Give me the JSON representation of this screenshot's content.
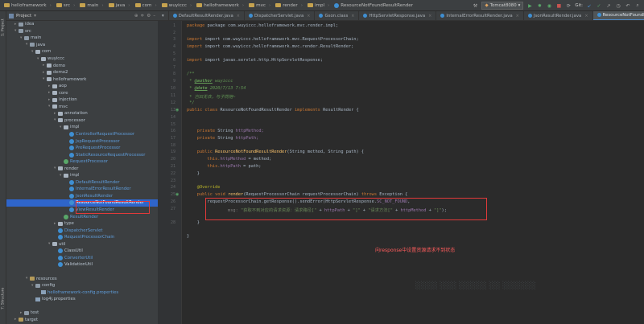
{
  "navbar": {
    "breadcrumbs": [
      "helloframework",
      "src",
      "main",
      "java",
      "com",
      "wuyiccc",
      "helloframework",
      "mvc",
      "render",
      "impl",
      "ResourceNotFoundResultRender"
    ],
    "run_config": "Tomcat8080",
    "git_label": "Git:"
  },
  "stripe": {
    "top_tabs": [
      "1: Project",
      "7: Structure"
    ],
    "bottom_tabs": [
      "Web",
      "2: Favorites"
    ]
  },
  "project": {
    "title": "Project",
    "tree": [
      {
        "label": "idea",
        "depth": 1,
        "arrow": "▸",
        "icon": "folder"
      },
      {
        "label": "src",
        "depth": 1,
        "arrow": "▾",
        "icon": "folder"
      },
      {
        "label": "main",
        "depth": 2,
        "arrow": "▾",
        "icon": "folder"
      },
      {
        "label": "java",
        "depth": 3,
        "arrow": "▾",
        "icon": "folder"
      },
      {
        "label": "com",
        "depth": 4,
        "arrow": "▾",
        "icon": "pkg"
      },
      {
        "label": "wuyiccc",
        "depth": 5,
        "arrow": "▾",
        "icon": "pkg"
      },
      {
        "label": "demo",
        "depth": 6,
        "arrow": "▸",
        "icon": "pkg"
      },
      {
        "label": "demo2",
        "depth": 6,
        "arrow": "▸",
        "icon": "pkg"
      },
      {
        "label": "helloframework",
        "depth": 6,
        "arrow": "▾",
        "icon": "pkg"
      },
      {
        "label": "aop",
        "depth": 7,
        "arrow": "▸",
        "icon": "pkg"
      },
      {
        "label": "core",
        "depth": 7,
        "arrow": "▸",
        "icon": "pkg"
      },
      {
        "label": "injection",
        "depth": 7,
        "arrow": "▸",
        "icon": "pkg"
      },
      {
        "label": "mvc",
        "depth": 7,
        "arrow": "▾",
        "icon": "pkg"
      },
      {
        "label": "annotation",
        "depth": 8,
        "arrow": "▸",
        "icon": "pkg"
      },
      {
        "label": "processor",
        "depth": 8,
        "arrow": "▾",
        "icon": "pkg"
      },
      {
        "label": "impl",
        "depth": 9,
        "arrow": "▾",
        "icon": "pkg"
      },
      {
        "label": "ControllerRequestProcessor",
        "depth": 10,
        "arrow": "",
        "icon": "cls",
        "blue": true
      },
      {
        "label": "JspRequestProcessor",
        "depth": 10,
        "arrow": "",
        "icon": "cls",
        "blue": true
      },
      {
        "label": "PreRequestProcessor",
        "depth": 10,
        "arrow": "",
        "icon": "cls",
        "blue": true
      },
      {
        "label": "StaticResourceRequestProcessor",
        "depth": 10,
        "arrow": "",
        "icon": "cls",
        "blue": true
      },
      {
        "label": "RequestProcessor",
        "depth": 9,
        "arrow": "",
        "icon": "cls-i",
        "blue": true
      },
      {
        "label": "render",
        "depth": 8,
        "arrow": "▾",
        "icon": "pkg"
      },
      {
        "label": "impl",
        "depth": 9,
        "arrow": "▾",
        "icon": "pkg"
      },
      {
        "label": "DefaultResultRender",
        "depth": 10,
        "arrow": "",
        "icon": "cls",
        "blue": true
      },
      {
        "label": "InternalErrorResultRender",
        "depth": 10,
        "arrow": "",
        "icon": "cls",
        "blue": true
      },
      {
        "label": "JsonResultRender",
        "depth": 10,
        "arrow": "",
        "icon": "cls",
        "blue": true
      },
      {
        "label": "ResourceNotFoundResultRender",
        "depth": 10,
        "arrow": "",
        "icon": "cls",
        "highlight": true
      },
      {
        "label": "ViewResultRender",
        "depth": 10,
        "arrow": "",
        "icon": "cls",
        "blue": true
      },
      {
        "label": "ResultRender",
        "depth": 9,
        "arrow": "",
        "icon": "cls-i",
        "blue": true
      },
      {
        "label": "type",
        "depth": 8,
        "arrow": "▸",
        "icon": "pkg"
      },
      {
        "label": "DispatcherServlet",
        "depth": 8,
        "arrow": "",
        "icon": "cls",
        "blue": true
      },
      {
        "label": "RequestProcessorChain",
        "depth": 8,
        "arrow": "",
        "icon": "cls",
        "blue": true
      },
      {
        "label": "util",
        "depth": 7,
        "arrow": "▾",
        "icon": "pkg"
      },
      {
        "label": "ClassUtil",
        "depth": 8,
        "arrow": "",
        "icon": "cls"
      },
      {
        "label": "ConverterUtil",
        "depth": 8,
        "arrow": "",
        "icon": "cls",
        "blue": true
      },
      {
        "label": "ValidationUtil",
        "depth": 8,
        "arrow": "",
        "icon": "cls"
      },
      {
        "label": "",
        "depth": 0,
        "arrow": "",
        "icon": "none"
      },
      {
        "label": "resources",
        "depth": 3,
        "arrow": "▾",
        "icon": "res"
      },
      {
        "label": "config",
        "depth": 4,
        "arrow": "▾",
        "icon": "folder"
      },
      {
        "label": "helloframework-config.properties",
        "depth": 5,
        "arrow": "",
        "icon": "file",
        "blue": true
      },
      {
        "label": "log4j.properties",
        "depth": 4,
        "arrow": "",
        "icon": "file"
      },
      {
        "label": "",
        "depth": 0,
        "arrow": "",
        "icon": "none"
      },
      {
        "label": "test",
        "depth": 2,
        "arrow": "▸",
        "icon": "folder"
      },
      {
        "label": "target",
        "depth": 1,
        "arrow": "▸",
        "icon": "res"
      },
      {
        "label": "helloframework.iml",
        "depth": 1,
        "arrow": "",
        "icon": "file"
      },
      {
        "label": "pom.xml",
        "depth": 1,
        "arrow": "",
        "icon": "xml",
        "blue": true
      }
    ]
  },
  "tabs": [
    {
      "label": "DefaultResultRender.java"
    },
    {
      "label": "DispatcherServlet.java"
    },
    {
      "label": "Gson.class"
    },
    {
      "label": "HttpServletResponse.java"
    },
    {
      "label": "InternalErrorResultRender.java"
    },
    {
      "label": "JsonResultRender.java"
    },
    {
      "label": "ResourceNotFoundResultRender.java",
      "active": true
    }
  ],
  "editor": {
    "line_numbers": [
      "1",
      "2",
      "3",
      "4",
      "5",
      "6",
      "7",
      "8",
      "9",
      "10",
      "11",
      "12",
      "13",
      "14",
      "15",
      "16",
      "17",
      "18",
      "19",
      "20",
      "21",
      "22",
      "23",
      "24",
      "25",
      "26",
      "27",
      "28"
    ],
    "code": {
      "l1": [
        "package com.wuyiccc.helloframework.mvc.render.impl;"
      ],
      "l3": [
        "import com.wuyiccc.helloframework.mvc.RequestProcessorChain;"
      ],
      "l4": [
        "import com.wuyiccc.helloframework.mvc.render.ResultRender;"
      ],
      "l6": [
        "import javax.servlet.http.HttpServletResponse;"
      ],
      "l8": "/**",
      "l9_tag": "@author",
      "l9_val": "wuyiccc",
      "l10_tag": "@date",
      "l10_val": "2020/7/13 7:54",
      "l11": " * 岂曰无衣，与子同袍~",
      "l12": " */",
      "l13_a": "public class",
      "l13_b": "ResourceNotFoundResultRender",
      "l13_c": "implements",
      "l13_d": "ResultRender {",
      "l16_a": "private",
      "l16_b": "String",
      "l16_c": "httpMethod;",
      "l17_a": "private",
      "l17_b": "String",
      "l17_c": "httpPath;",
      "l19_a": "public",
      "l19_b": "ResourceNotFoundResultRender",
      "l19_c": "(String method, String path) {",
      "l20_a": "this.",
      "l20_b": "httpMethod",
      "l20_c": " = method;",
      "l21_a": "this.",
      "l21_b": "httpPath",
      "l21_c": " = path;",
      "l22": "}",
      "l24": "@Override",
      "l25_a": "public void",
      "l25_b": "render",
      "l25_c": "(RequestProcessorChain requestProcessorChain)",
      "l25_d": "throws",
      "l25_e": "Exception {",
      "l26_a": "requestProcessorChain.getResponse().sendError(HttpServletResponse.",
      "l26_b": "SC_NOT_FOUND",
      "l26_c": ",",
      "l27_hint": "msg:",
      "l27_a": "\"获取不到对应的请求资源：请求路径[\"",
      "l27_b": " + ",
      "l27_c": "httpPath",
      "l27_d": " + ",
      "l27_e": "\"]\"",
      "l27_f": " + ",
      "l27_g": "\"请求方法[\"",
      "l27_h": " + ",
      "l27_i": "httpMethod",
      "l27_j": " + ",
      "l27_k": "\"]\"",
      "l27_l": ");",
      "l28": "}",
      "l30": "}"
    },
    "annotation_note": "向response中设置资源请求不到状态"
  }
}
